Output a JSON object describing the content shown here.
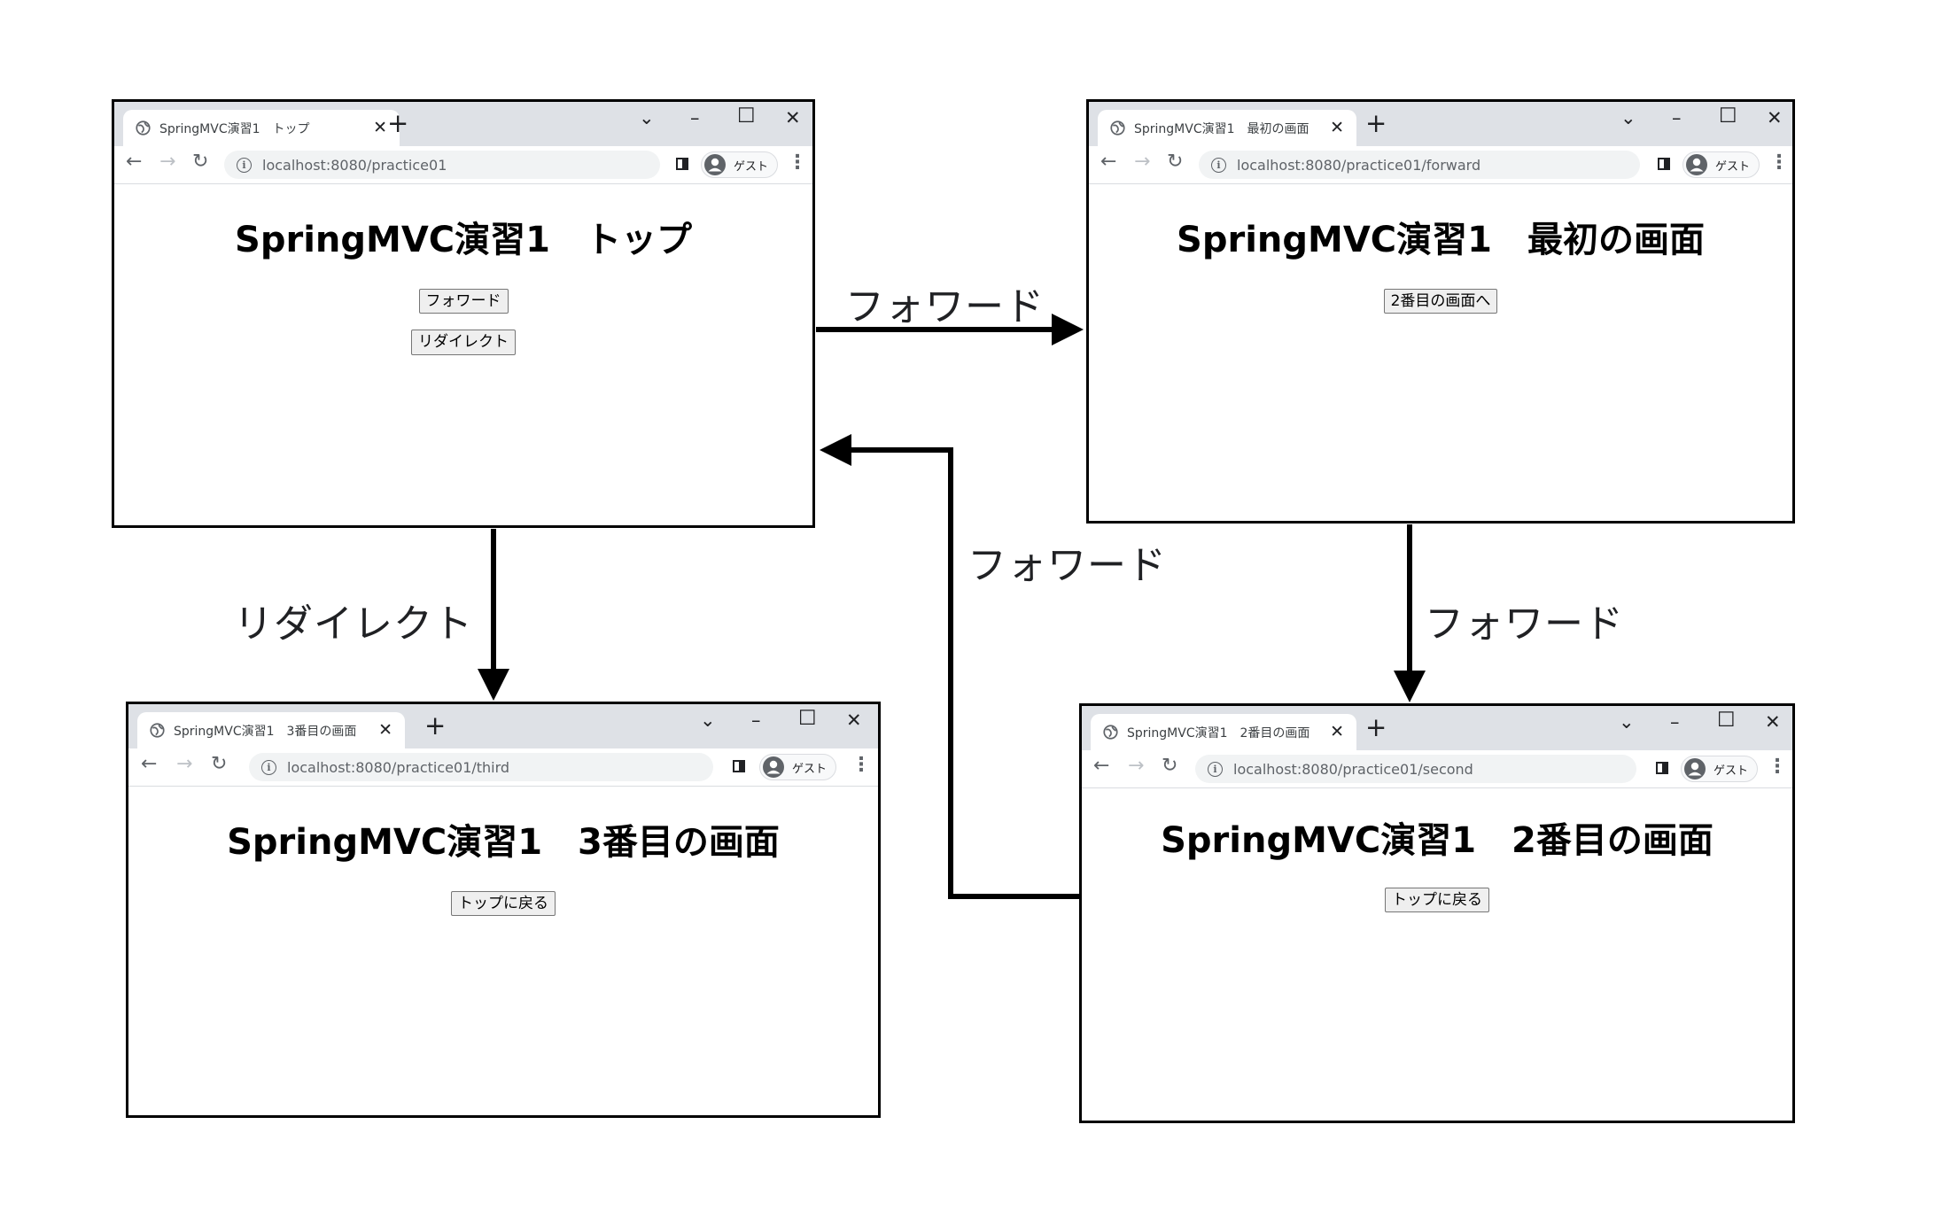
{
  "windows": {
    "top": {
      "tab_title": "SpringMVC演習1　トップ",
      "url": "localhost:8080/practice01",
      "guest_label": "ゲスト",
      "heading": "SpringMVC演習1　トップ",
      "buttons": [
        "フォワード",
        "リダイレクト"
      ]
    },
    "first": {
      "tab_title": "SpringMVC演習1　最初の画面",
      "url": "localhost:8080/practice01/forward",
      "guest_label": "ゲスト",
      "heading": "SpringMVC演習1　最初の画面",
      "buttons": [
        "2番目の画面へ"
      ]
    },
    "third": {
      "tab_title": "SpringMVC演習1　3番目の画面",
      "url": "localhost:8080/practice01/third",
      "guest_label": "ゲスト",
      "heading": "SpringMVC演習1　3番目の画面",
      "buttons": [
        "トップに戻る"
      ]
    },
    "second": {
      "tab_title": "SpringMVC演習1　2番目の画面",
      "url": "localhost:8080/practice01/second",
      "guest_label": "ゲスト",
      "heading": "SpringMVC演習1　2番目の画面",
      "buttons": [
        "トップに戻る"
      ]
    }
  },
  "edges": {
    "top_to_first": "フォワード",
    "top_to_third": "リダイレクト",
    "first_to_second": "フォワード",
    "second_to_top": "フォワード"
  },
  "icons": {
    "favicon": "globe-icon",
    "profile": "account-circle-icon",
    "security": "info-icon"
  },
  "colors": {
    "titlebar": "#dee1e6",
    "omnibox": "#f1f3f4",
    "arrow": "#000000"
  }
}
